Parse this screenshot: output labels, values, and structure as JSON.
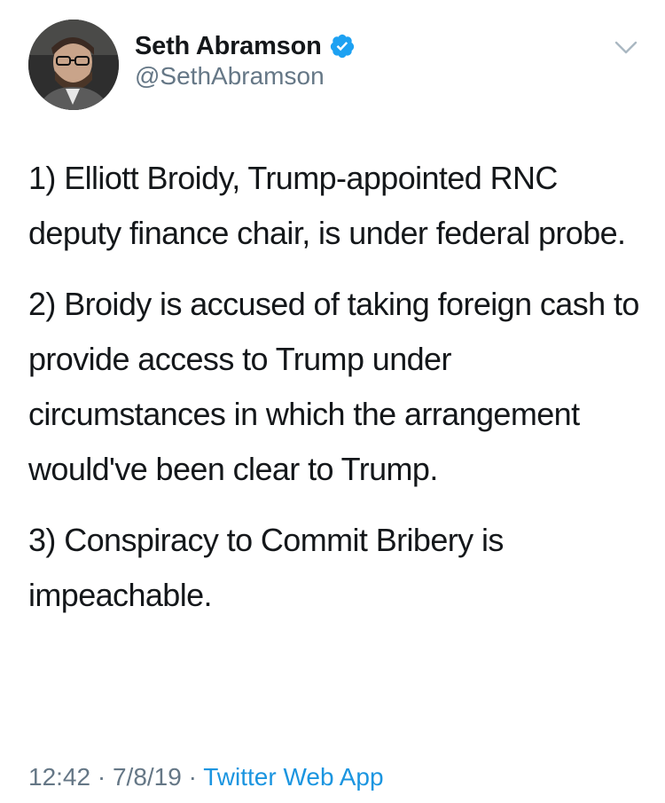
{
  "author": {
    "display_name": "Seth Abramson",
    "handle": "@SethAbramson",
    "verified_icon": "verified-badge-icon",
    "avatar_icon": "profile-photo"
  },
  "menu": {
    "icon": "chevron-down-icon"
  },
  "tweet": {
    "paragraphs": [
      "1) Elliott Broidy, Trump-appointed RNC deputy finance chair, is under federal probe.",
      "2) Broidy is accused of taking foreign cash to provide access to Trump under circumstances in which the arrangement would've been clear to Trump.",
      "3) Conspiracy to Commit Bribery is impeachable."
    ]
  },
  "meta": {
    "time": "12:42",
    "separator": " · ",
    "date": "7/8/19",
    "source": "Twitter Web App"
  },
  "colors": {
    "text": "#14171a",
    "muted": "#657786",
    "link": "#1b95e0",
    "verified": "#1da1f2"
  }
}
